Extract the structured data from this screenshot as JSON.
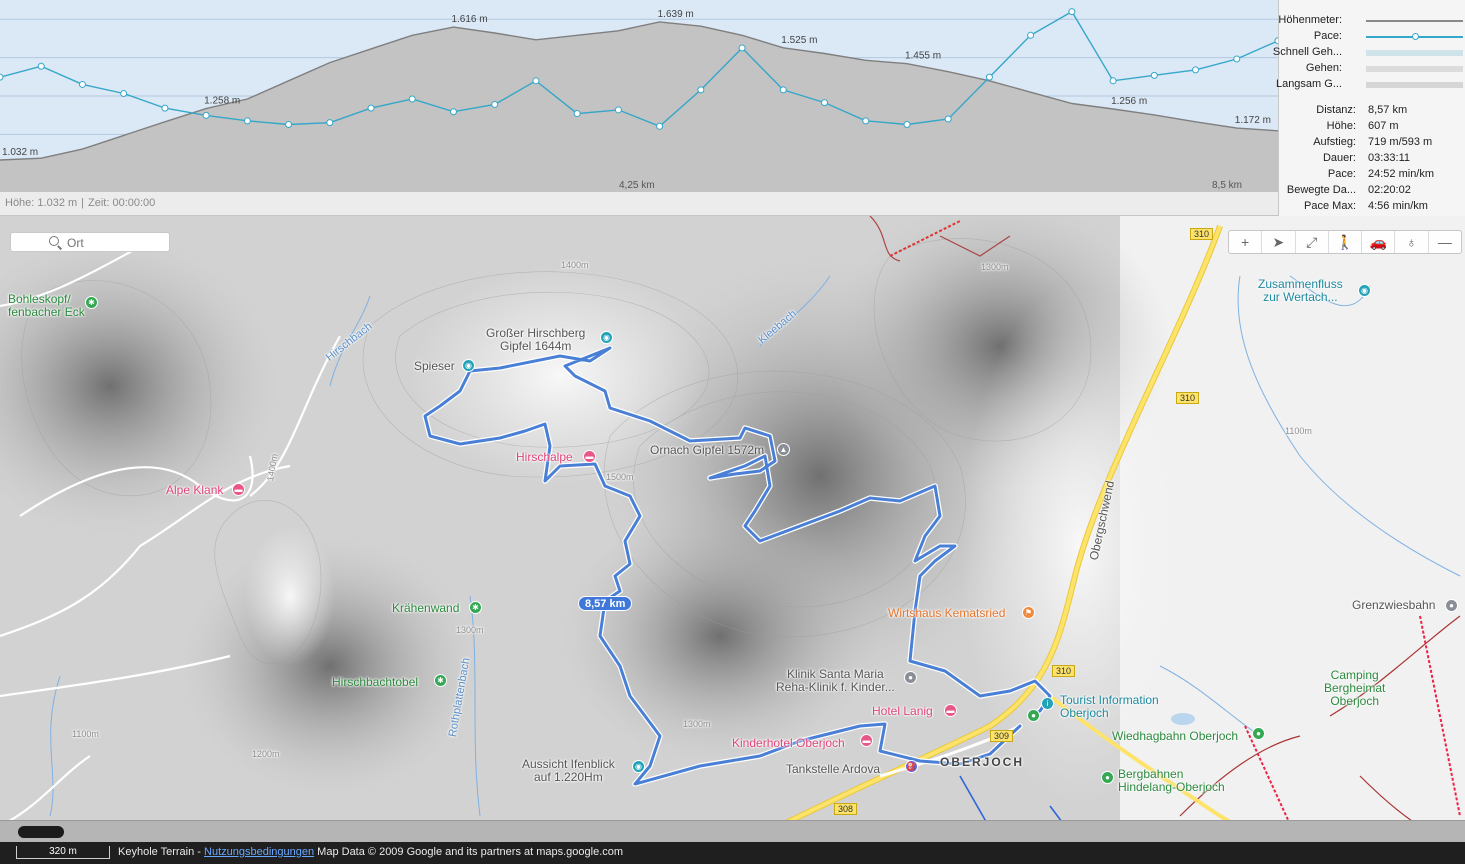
{
  "chart": {
    "elevation_labels": [
      "1.032 m",
      "1.258 m",
      "1.616 m",
      "1.639 m",
      "1.525 m",
      "1.455 m",
      "1.256 m",
      "1.172 m"
    ],
    "distance_labels": [
      "4,25 km",
      "8,5 km"
    ],
    "status_height": "Höhe: 1.032 m",
    "status_time": "Zeit: 00:00:00",
    "colors": {
      "elevation_fill": "#c3c3c3",
      "elevation_line": "#7f7f7f",
      "pace_line": "#35a7c9",
      "background": "#dbe8f6"
    },
    "elevation_profile_m": [
      1032,
      1040,
      1080,
      1140,
      1200,
      1258,
      1300,
      1380,
      1460,
      1520,
      1580,
      1616,
      1590,
      1560,
      1580,
      1600,
      1639,
      1620,
      1580,
      1525,
      1500,
      1470,
      1455,
      1420,
      1380,
      1330,
      1280,
      1256,
      1230,
      1200,
      1172,
      1160
    ],
    "pace_profile": [
      0.62,
      0.68,
      0.58,
      0.53,
      0.45,
      0.41,
      0.38,
      0.36,
      0.37,
      0.45,
      0.5,
      0.43,
      0.47,
      0.6,
      0.42,
      0.44,
      0.35,
      0.55,
      0.78,
      0.55,
      0.48,
      0.38,
      0.36,
      0.39,
      0.62,
      0.85,
      0.98,
      0.6,
      0.63,
      0.66,
      0.72,
      0.82
    ]
  },
  "legend": [
    {
      "label": "Höhenmeter:",
      "color": "#8a8a8a",
      "style": "line"
    },
    {
      "label": "Pace:",
      "color": "#35a7c9",
      "style": "line-dot"
    },
    {
      "label": "Schnell Geh...",
      "color": "#cfe4ea",
      "style": "bar"
    },
    {
      "label": "Gehen:",
      "color": "#dcdcdc",
      "style": "bar"
    },
    {
      "label": "Langsam G...",
      "color": "#d6d6d6",
      "style": "bar"
    }
  ],
  "stats": [
    {
      "label": "Distanz:",
      "value": "8,57 km"
    },
    {
      "label": "Höhe:",
      "value": "607 m"
    },
    {
      "label": "Aufstieg:",
      "value": "719 m/593 m"
    },
    {
      "label": "Dauer:",
      "value": "03:33:11"
    },
    {
      "label": "Pace:",
      "value": "24:52 min/km"
    },
    {
      "label": "Bewegte Da...",
      "value": "02:20:02"
    },
    {
      "label": "Pace Max:",
      "value": "4:56 min/km"
    }
  ],
  "map": {
    "search_placeholder": "Ort",
    "route_distance": "8,57 km",
    "route_color": "#4a7fd6",
    "toolbar_icons": [
      "zoom-in-icon",
      "location-arrow-icon",
      "fullscreen-icon",
      "walking-icon",
      "car-icon",
      "balloon-icon",
      "zoom-out-icon"
    ],
    "places": {
      "bohleskopf": "Bohleskopf/\nfenbacher Eck",
      "grosser_hirschberg": "Großer Hirschberg\nGipfel 1644m",
      "spieser": "Spieser",
      "hirschalpe": "Hirschalpe",
      "ornach": "Ornach Gipfel 1572m",
      "alpe_klank": "Alpe Klank",
      "kraehenwand": "Krähenwand",
      "hirschbachtobel": "Hirschbachtobel",
      "aussicht": "Aussicht Ifenblick\nauf 1.220Hm",
      "wirtshaus": "Wirtshaus Kematsried",
      "klinik": "Klinik Santa Maria\nReha-Klinik f. Kinder...",
      "hotel_lanig": "Hotel Lanig",
      "kinderhotel": "Kinderhotel Oberjoch",
      "tankstelle": "Tankstelle Ardova",
      "oberjoch": "OBERJOCH",
      "tourist_info": "Tourist Information\nOberjoch",
      "wiedhagbahn": "Wiedhagbahn Oberjoch",
      "bergbahnen": "Bergbahnen\nHindelang-Oberjoch",
      "camping": "Camping\nBergheimat\nOberjoch",
      "grenzwiesbahn": "Grenzwiesbahn",
      "zusammenfluss": "Zusammenfluss\nzur Wertach..."
    },
    "streams": {
      "hirschbach": "Hirschbach",
      "kleebach": "Kleebach",
      "rothplattenbach": "Rothplattenbach",
      "obergschwend": "Obergschwend"
    },
    "roads": {
      "r310_a": "310",
      "r310_b": "310",
      "r310_c": "310",
      "r308": "308",
      "r309": "309"
    },
    "contours": {
      "c1400a": "1400m",
      "c1500a": "1500m",
      "c1400b": "1400m",
      "c1300a": "1300m",
      "c1300b": "1300m",
      "c1200a": "1200m",
      "c1100a": "1100m",
      "c1300c": "1300m",
      "c1100b": "1100m"
    },
    "scale": "320 m",
    "attribution_prefix": "Keyhole Terrain - ",
    "attribution_link": "Nutzungsbedingungen",
    "attribution_suffix": " Map Data © 2009 Google and its partners at maps.google.com"
  }
}
